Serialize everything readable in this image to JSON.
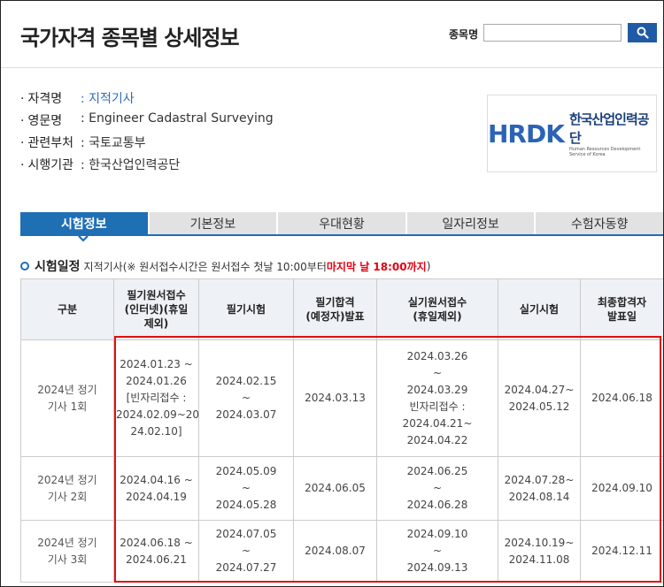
{
  "header": {
    "title": "국가자격 종목별 상세정보",
    "search_label": "종목명",
    "search_value": ""
  },
  "info": [
    {
      "key": "자격명",
      "value": ": 지적기사",
      "link": true
    },
    {
      "key": "영문명",
      "value": ": Engineer Cadastral Surveying",
      "link": false
    },
    {
      "key": "관련부처",
      "value": ": 국토교통부",
      "link": false
    },
    {
      "key": "시행기관",
      "value": ": 한국산업인력공단",
      "link": false
    }
  ],
  "logo": {
    "mark": "HRDK",
    "kr": "한국산업인력공단",
    "en": "Human Resources Development Service of Korea"
  },
  "tabs": [
    "시험정보",
    "기본정보",
    "우대현황",
    "일자리정보",
    "수험자동향"
  ],
  "active_tab": 0,
  "section": {
    "title": "시험일정",
    "subject": "지적기사",
    "note_pre": "(※ 원서접수시간은 원서접수 첫날 10:00부터 ",
    "note_red": "마지막 날 18:00까지",
    "note_post": ")"
  },
  "table": {
    "headers": [
      [
        "구분"
      ],
      [
        "필기원서접수",
        "(인터넷)(휴일",
        "제외)"
      ],
      [
        "필기시험"
      ],
      [
        "필기합격",
        "(예정자)발표"
      ],
      [
        "실기원서접수",
        "(휴일제외)"
      ],
      [
        "실기시험"
      ],
      [
        "최종합격자",
        "발표일"
      ]
    ],
    "rows": [
      [
        [
          "2024년 정기",
          "기사 1회"
        ],
        [
          "2024.01.23 ~",
          "2024.01.26",
          "[빈자리접수 :",
          "2024.02.09~20",
          "24.02.10]"
        ],
        [
          "2024.02.15",
          "~",
          "2024.03.07"
        ],
        [
          "2024.03.13"
        ],
        [
          "2024.03.26",
          "~",
          "2024.03.29",
          "빈자리접수 :",
          "2024.04.21~",
          "2024.04.22"
        ],
        [
          "2024.04.27~",
          "2024.05.12"
        ],
        [
          "2024.06.18"
        ]
      ],
      [
        [
          "2024년 정기",
          "기사 2회"
        ],
        [
          "2024.04.16 ~",
          "2024.04.19"
        ],
        [
          "2024.05.09",
          "~",
          "2024.05.28"
        ],
        [
          "2024.06.05"
        ],
        [
          "2024.06.25",
          "~",
          "2024.06.28"
        ],
        [
          "2024.07.28~",
          "2024.08.14"
        ],
        [
          "2024.09.10"
        ]
      ],
      [
        [
          "2024년 정기",
          "기사 3회"
        ],
        [
          "2024.06.18 ~",
          "2024.06.21"
        ],
        [
          "2024.07.05",
          "~",
          "2024.07.27"
        ],
        [
          "2024.08.07"
        ],
        [
          "2024.09.10",
          "~",
          "2024.09.13"
        ],
        [
          "2024.10.19~",
          "2024.11.08"
        ],
        [
          "2024.12.11"
        ]
      ]
    ]
  },
  "colors": {
    "accent": "#1f6fb5",
    "highlight": "#e01010"
  }
}
